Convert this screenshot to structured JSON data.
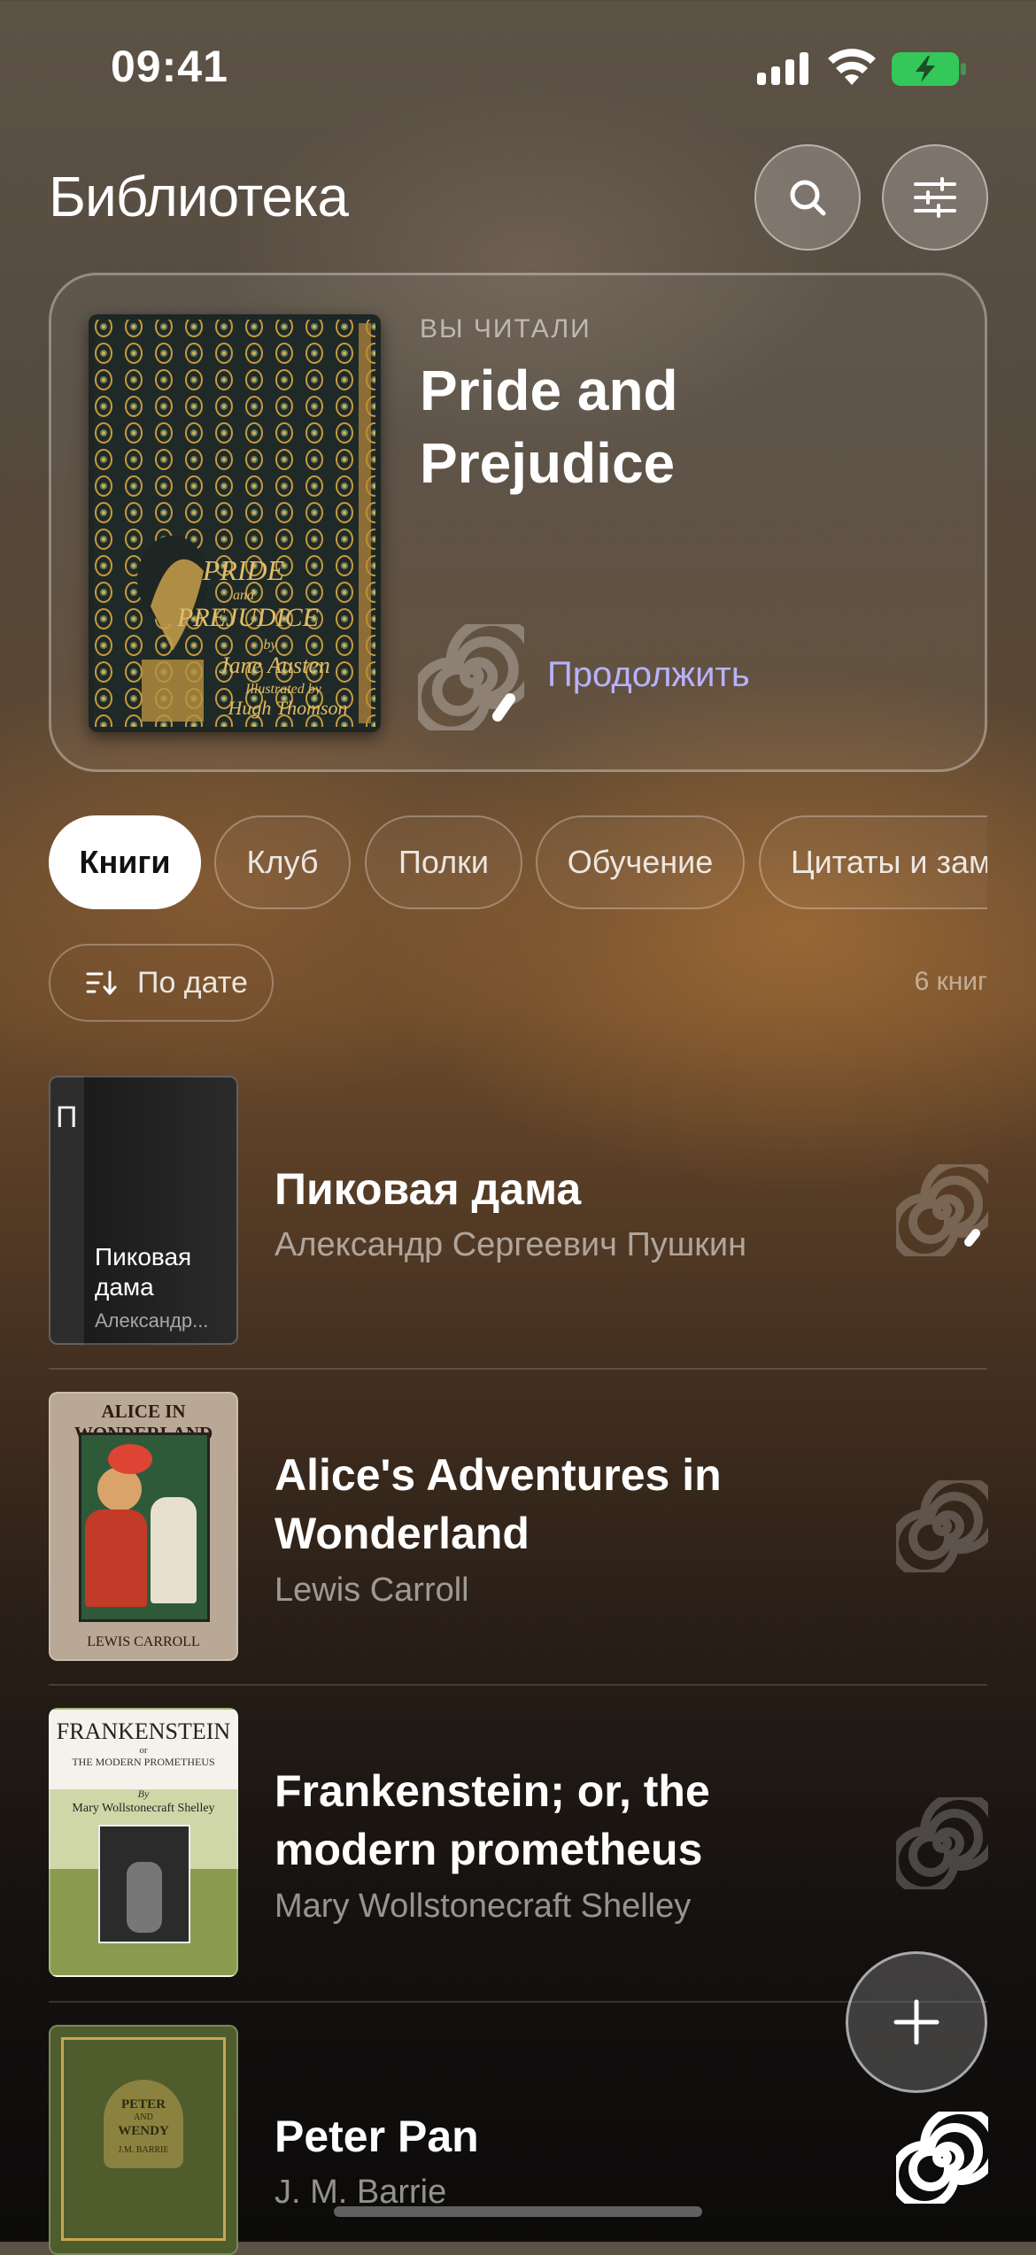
{
  "status_bar": {
    "time": "09:41"
  },
  "header": {
    "title": "Библиотека"
  },
  "recent": {
    "label": "ВЫ ЧИТАЛИ",
    "title": "Pride and Prejudice",
    "continue_label": "Продолжить",
    "cover": {
      "line1": "PRIDE",
      "line2": "and",
      "line3": "PREJUDICE",
      "line4": "by",
      "line5": "Jane Austen",
      "line6": "Illustrated by",
      "line7": "Hugh Thomson"
    }
  },
  "tabs": [
    {
      "label": "Книги",
      "active": true
    },
    {
      "label": "Клуб",
      "active": false
    },
    {
      "label": "Полки",
      "active": false
    },
    {
      "label": "Обучение",
      "active": false
    },
    {
      "label": "Цитаты и заметки",
      "active": false
    }
  ],
  "sort": {
    "label": "По дате",
    "count": "6 книг"
  },
  "books": [
    {
      "title": "Пиковая дама",
      "author": "Александр Сергеевич Пушкин",
      "cover_glyph": "П",
      "cover_title": "Пиковая дама",
      "cover_author": "Александр..."
    },
    {
      "title": "Alice's Adventures in Wonderland",
      "author": "Lewis Carroll",
      "cover_top": "ALICE IN WONDERLAND",
      "cover_bottom": "LEWIS CARROLL"
    },
    {
      "title": "Frankenstein; or, the modern prometheus",
      "author": "Mary Wollstonecraft Shelley",
      "cover_top": "FRANKENSTEIN",
      "cover_sub1": "or",
      "cover_sub2": "THE MODERN PROMETHEUS",
      "cover_sub3": "By",
      "cover_sub4": "Mary Wollstonecraft Shelley"
    },
    {
      "title": "Peter Pan",
      "author": "J. M. Barrie",
      "cover_line1": "PETER",
      "cover_line2": "AND",
      "cover_line3": "WENDY",
      "cover_line4": "J.M. BARRIE"
    }
  ],
  "colors": {
    "accent_link": "#b7b2ff",
    "battery_green": "#34c759"
  },
  "icons": [
    "search-icon",
    "filter-sliders-icon",
    "sort-icon",
    "spiral-progress-icon",
    "plus-icon"
  ]
}
